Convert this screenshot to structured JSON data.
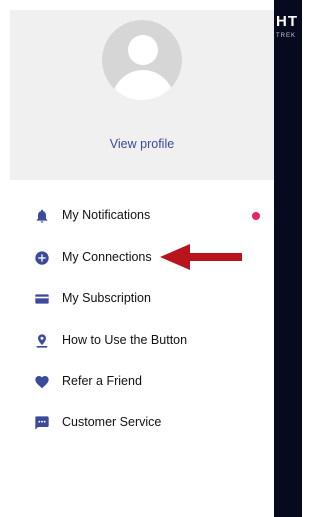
{
  "backdrop": {
    "logo_text": "HT",
    "logo_subtext": "TREK"
  },
  "profile": {
    "view_profile_label": "View profile"
  },
  "menu": {
    "items": [
      {
        "label": "My Notifications",
        "icon": "bell-icon",
        "has_notification_dot": true
      },
      {
        "label": "My Connections",
        "icon": "plus-circle-icon"
      },
      {
        "label": "My Subscription",
        "icon": "credit-card-icon"
      },
      {
        "label": "How to Use the Button",
        "icon": "location-pin-icon"
      },
      {
        "label": "Refer a Friend",
        "icon": "heart-icon"
      },
      {
        "label": "Customer Service",
        "icon": "chat-bubble-icon"
      }
    ]
  },
  "colors": {
    "accent": "#3b4a9a",
    "notification_dot": "#e8265e",
    "annotation_arrow": "#b8141c",
    "backdrop": "#060a1e",
    "header_bg": "#f0f0f0"
  }
}
